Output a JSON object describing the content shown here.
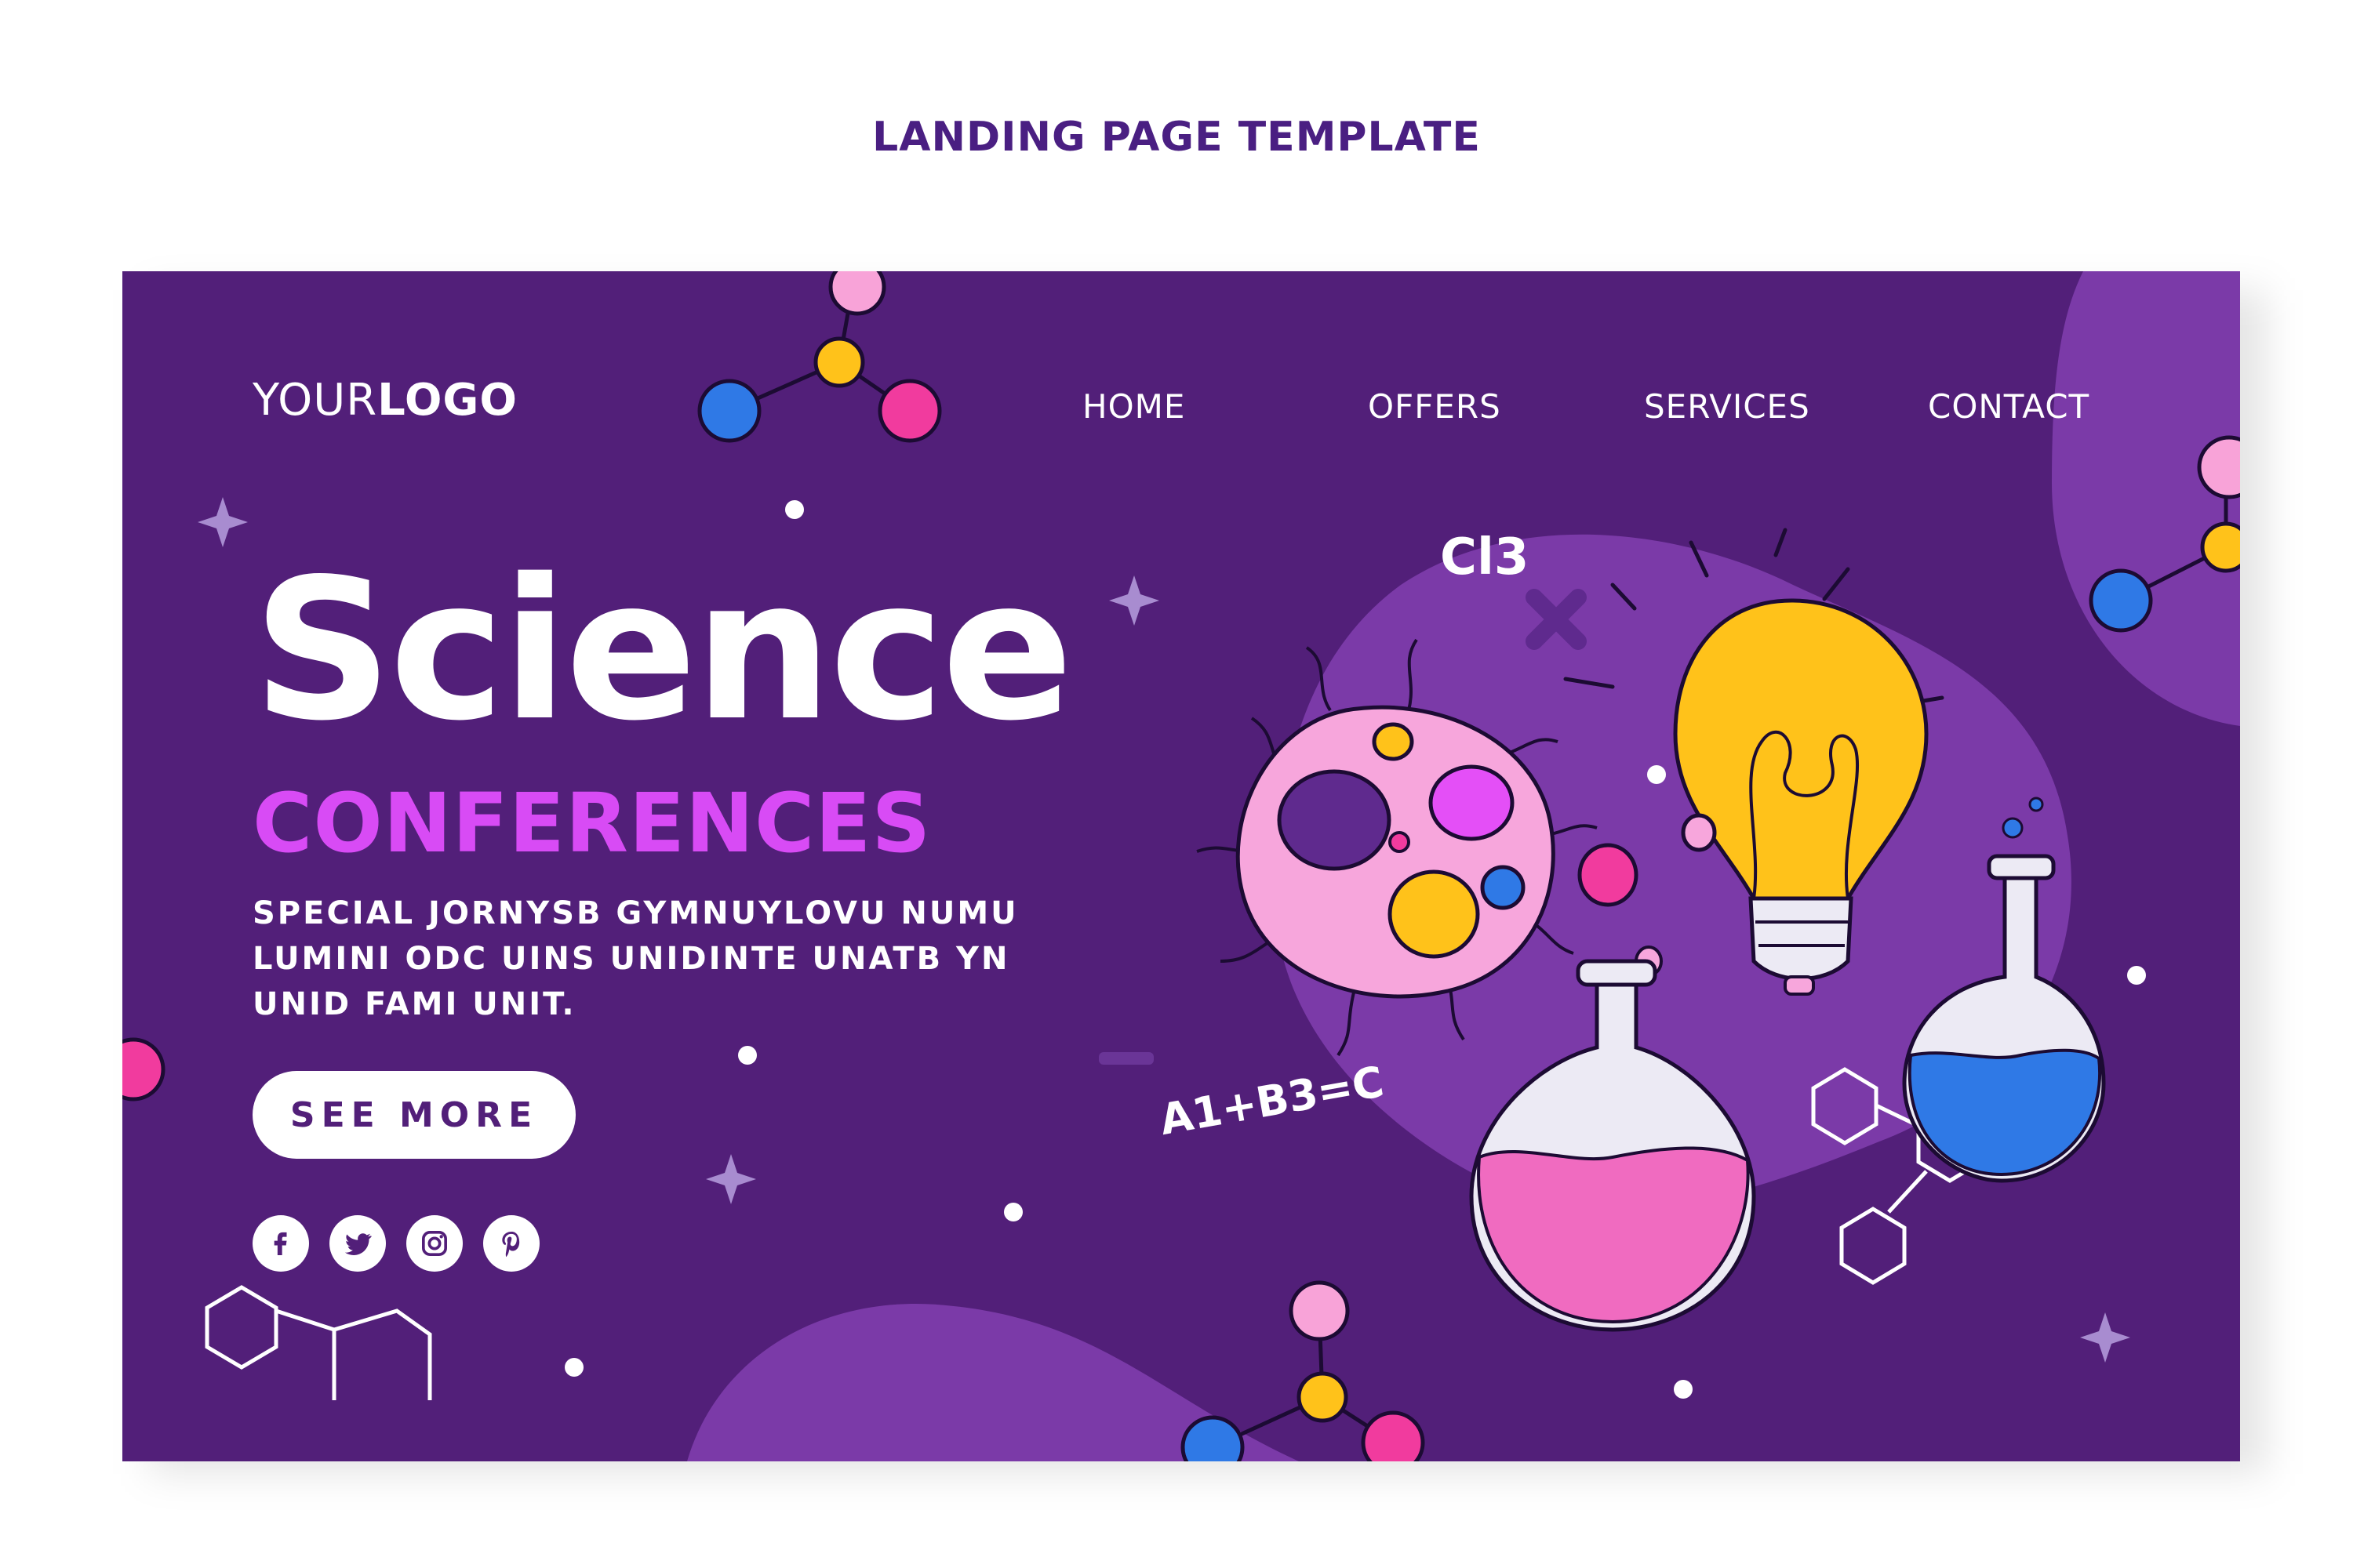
{
  "page_heading": "LANDING PAGE TEMPLATE",
  "logo": {
    "regular": "YOUR",
    "bold": "LOGO"
  },
  "nav": {
    "items": [
      "HOME",
      "OFFERS",
      "SERVICES",
      "CONTACT"
    ]
  },
  "hero": {
    "headline": "Science",
    "subheadline": "CONFERENCES",
    "description": "SPECIAL JORNYSB GYMNUYLOVU NUMU LUMINI ODC UINS UNIDINTE UNATB YN UNID FAMI UNIT.",
    "cta_label": "SEE MORE"
  },
  "socials": [
    "facebook-icon",
    "twitter-icon",
    "instagram-icon",
    "pinterest-icon"
  ],
  "doodles": {
    "formula_top": "Cl3",
    "formula_bottom": "A1+B3=C"
  },
  "colors": {
    "background": "#521f79",
    "blob": "#7b3aa8",
    "accent_magenta": "#d84bf5",
    "accent_pink": "#f06bc0",
    "accent_yellow": "#ffc21a",
    "accent_blue": "#2f79e6",
    "heading": "#4a1f82"
  }
}
